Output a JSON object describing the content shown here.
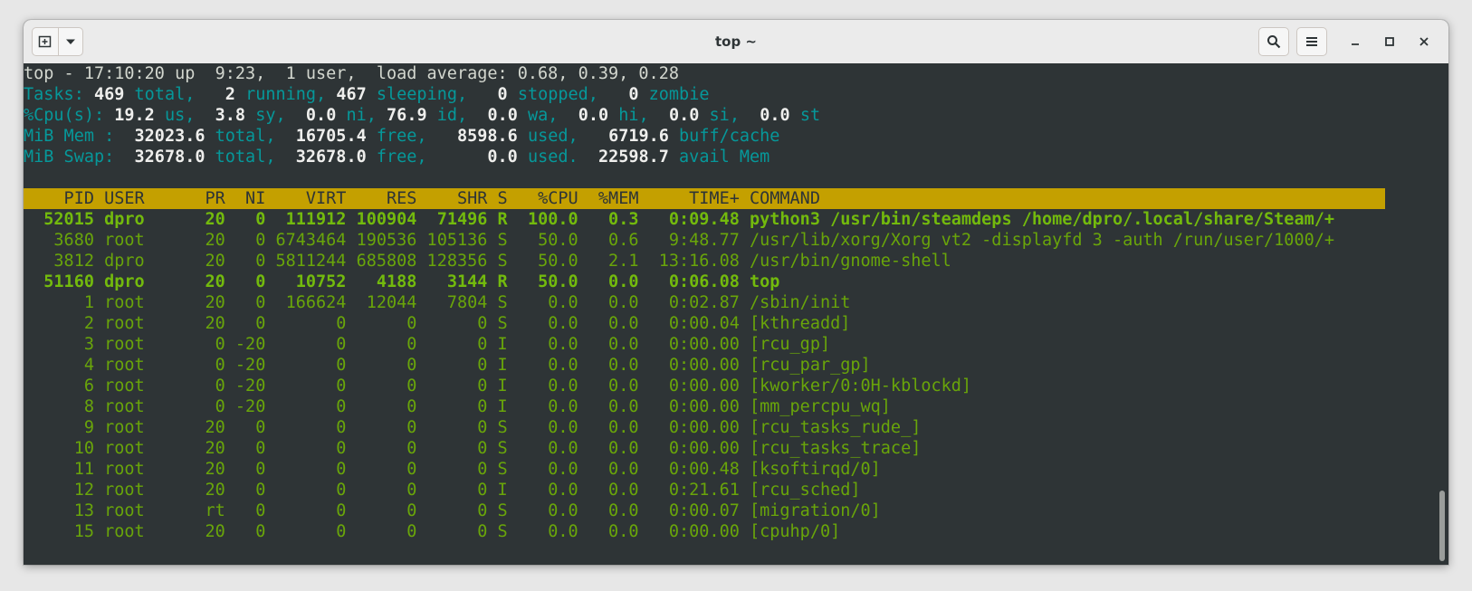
{
  "window": {
    "title": "top ~",
    "icons": {
      "new_tab": "new-tab-icon",
      "tab_menu": "chevron-down-icon",
      "search": "search-icon",
      "menu": "hamburger-menu-icon",
      "minimize": "minimize-icon",
      "maximize": "maximize-icon",
      "close": "close-icon"
    }
  },
  "summary": {
    "line1": "top - 17:10:20 up  9:23,  1 user,  load average: 0.68, 0.39, 0.28",
    "tasks": {
      "label": "Tasks:",
      "total": "469",
      "total_lbl": "total,",
      "running": "2",
      "running_lbl": "running,",
      "sleeping": "467",
      "sleeping_lbl": "sleeping,",
      "stopped": "0",
      "stopped_lbl": "stopped,",
      "zombie": "0",
      "zombie_lbl": "zombie"
    },
    "cpu": {
      "label": "%Cpu(s):",
      "us": "19.2",
      "us_lbl": "us,",
      "sy": "3.8",
      "sy_lbl": "sy,",
      "ni": "0.0",
      "ni_lbl": "ni,",
      "id": "76.9",
      "id_lbl": "id,",
      "wa": "0.0",
      "wa_lbl": "wa,",
      "hi": "0.0",
      "hi_lbl": "hi,",
      "si": "0.0",
      "si_lbl": "si,",
      "st": "0.0",
      "st_lbl": "st"
    },
    "mem": {
      "label": "MiB Mem :",
      "total": "32023.6",
      "total_lbl": "total,",
      "free": "16705.4",
      "free_lbl": "free,",
      "used": "8598.6",
      "used_lbl": "used,",
      "buff": "6719.6",
      "buff_lbl": "buff/cache"
    },
    "swap": {
      "label": "MiB Swap:",
      "total": "32678.0",
      "total_lbl": "total,",
      "free": "32678.0",
      "free_lbl": "free,",
      "used": "0.0",
      "used_lbl": "used.",
      "avail": "22598.7",
      "avail_lbl": "avail Mem"
    }
  },
  "table": {
    "columns": [
      "PID",
      "USER",
      "PR",
      "NI",
      "VIRT",
      "RES",
      "SHR",
      "S",
      "%CPU",
      "%MEM",
      "TIME+",
      "COMMAND"
    ],
    "rows": [
      {
        "pid": "52015",
        "user": "dpro",
        "pr": "20",
        "ni": "0",
        "virt": "111912",
        "res": "100904",
        "shr": "71496",
        "s": "R",
        "cpu": "100.0",
        "mem": "0.3",
        "time": "0:09.48",
        "cmd": "python3 /usr/bin/steamdeps /home/dpro/.local/share/Steam/+",
        "bold": true
      },
      {
        "pid": "3680",
        "user": "root",
        "pr": "20",
        "ni": "0",
        "virt": "6743464",
        "res": "190536",
        "shr": "105136",
        "s": "S",
        "cpu": "50.0",
        "mem": "0.6",
        "time": "9:48.77",
        "cmd": "/usr/lib/xorg/Xorg vt2 -displayfd 3 -auth /run/user/1000/+",
        "bold": false
      },
      {
        "pid": "3812",
        "user": "dpro",
        "pr": "20",
        "ni": "0",
        "virt": "5811244",
        "res": "685808",
        "shr": "128356",
        "s": "S",
        "cpu": "50.0",
        "mem": "2.1",
        "time": "13:16.08",
        "cmd": "/usr/bin/gnome-shell",
        "bold": false
      },
      {
        "pid": "51160",
        "user": "dpro",
        "pr": "20",
        "ni": "0",
        "virt": "10752",
        "res": "4188",
        "shr": "3144",
        "s": "R",
        "cpu": "50.0",
        "mem": "0.0",
        "time": "0:06.08",
        "cmd": "top",
        "bold": true
      },
      {
        "pid": "1",
        "user": "root",
        "pr": "20",
        "ni": "0",
        "virt": "166624",
        "res": "12044",
        "shr": "7804",
        "s": "S",
        "cpu": "0.0",
        "mem": "0.0",
        "time": "0:02.87",
        "cmd": "/sbin/init",
        "bold": false
      },
      {
        "pid": "2",
        "user": "root",
        "pr": "20",
        "ni": "0",
        "virt": "0",
        "res": "0",
        "shr": "0",
        "s": "S",
        "cpu": "0.0",
        "mem": "0.0",
        "time": "0:00.04",
        "cmd": "[kthreadd]",
        "bold": false
      },
      {
        "pid": "3",
        "user": "root",
        "pr": "0",
        "ni": "-20",
        "virt": "0",
        "res": "0",
        "shr": "0",
        "s": "I",
        "cpu": "0.0",
        "mem": "0.0",
        "time": "0:00.00",
        "cmd": "[rcu_gp]",
        "bold": false
      },
      {
        "pid": "4",
        "user": "root",
        "pr": "0",
        "ni": "-20",
        "virt": "0",
        "res": "0",
        "shr": "0",
        "s": "I",
        "cpu": "0.0",
        "mem": "0.0",
        "time": "0:00.00",
        "cmd": "[rcu_par_gp]",
        "bold": false
      },
      {
        "pid": "6",
        "user": "root",
        "pr": "0",
        "ni": "-20",
        "virt": "0",
        "res": "0",
        "shr": "0",
        "s": "I",
        "cpu": "0.0",
        "mem": "0.0",
        "time": "0:00.00",
        "cmd": "[kworker/0:0H-kblockd]",
        "bold": false
      },
      {
        "pid": "8",
        "user": "root",
        "pr": "0",
        "ni": "-20",
        "virt": "0",
        "res": "0",
        "shr": "0",
        "s": "I",
        "cpu": "0.0",
        "mem": "0.0",
        "time": "0:00.00",
        "cmd": "[mm_percpu_wq]",
        "bold": false
      },
      {
        "pid": "9",
        "user": "root",
        "pr": "20",
        "ni": "0",
        "virt": "0",
        "res": "0",
        "shr": "0",
        "s": "S",
        "cpu": "0.0",
        "mem": "0.0",
        "time": "0:00.00",
        "cmd": "[rcu_tasks_rude_]",
        "bold": false
      },
      {
        "pid": "10",
        "user": "root",
        "pr": "20",
        "ni": "0",
        "virt": "0",
        "res": "0",
        "shr": "0",
        "s": "S",
        "cpu": "0.0",
        "mem": "0.0",
        "time": "0:00.00",
        "cmd": "[rcu_tasks_trace]",
        "bold": false
      },
      {
        "pid": "11",
        "user": "root",
        "pr": "20",
        "ni": "0",
        "virt": "0",
        "res": "0",
        "shr": "0",
        "s": "S",
        "cpu": "0.0",
        "mem": "0.0",
        "time": "0:00.48",
        "cmd": "[ksoftirqd/0]",
        "bold": false
      },
      {
        "pid": "12",
        "user": "root",
        "pr": "20",
        "ni": "0",
        "virt": "0",
        "res": "0",
        "shr": "0",
        "s": "I",
        "cpu": "0.0",
        "mem": "0.0",
        "time": "0:21.61",
        "cmd": "[rcu_sched]",
        "bold": false
      },
      {
        "pid": "13",
        "user": "root",
        "pr": "rt",
        "ni": "0",
        "virt": "0",
        "res": "0",
        "shr": "0",
        "s": "S",
        "cpu": "0.0",
        "mem": "0.0",
        "time": "0:00.07",
        "cmd": "[migration/0]",
        "bold": false
      },
      {
        "pid": "15",
        "user": "root",
        "pr": "20",
        "ni": "0",
        "virt": "0",
        "res": "0",
        "shr": "0",
        "s": "S",
        "cpu": "0.0",
        "mem": "0.0",
        "time": "0:00.00",
        "cmd": "[cpuhp/0]",
        "bold": false
      }
    ]
  },
  "colors": {
    "terminal_bg": "#2e3436",
    "header_bg": "#c4a000",
    "label": "#06989a",
    "process_text": "#69a50a",
    "titlebar_bg": "#ebebeb"
  }
}
